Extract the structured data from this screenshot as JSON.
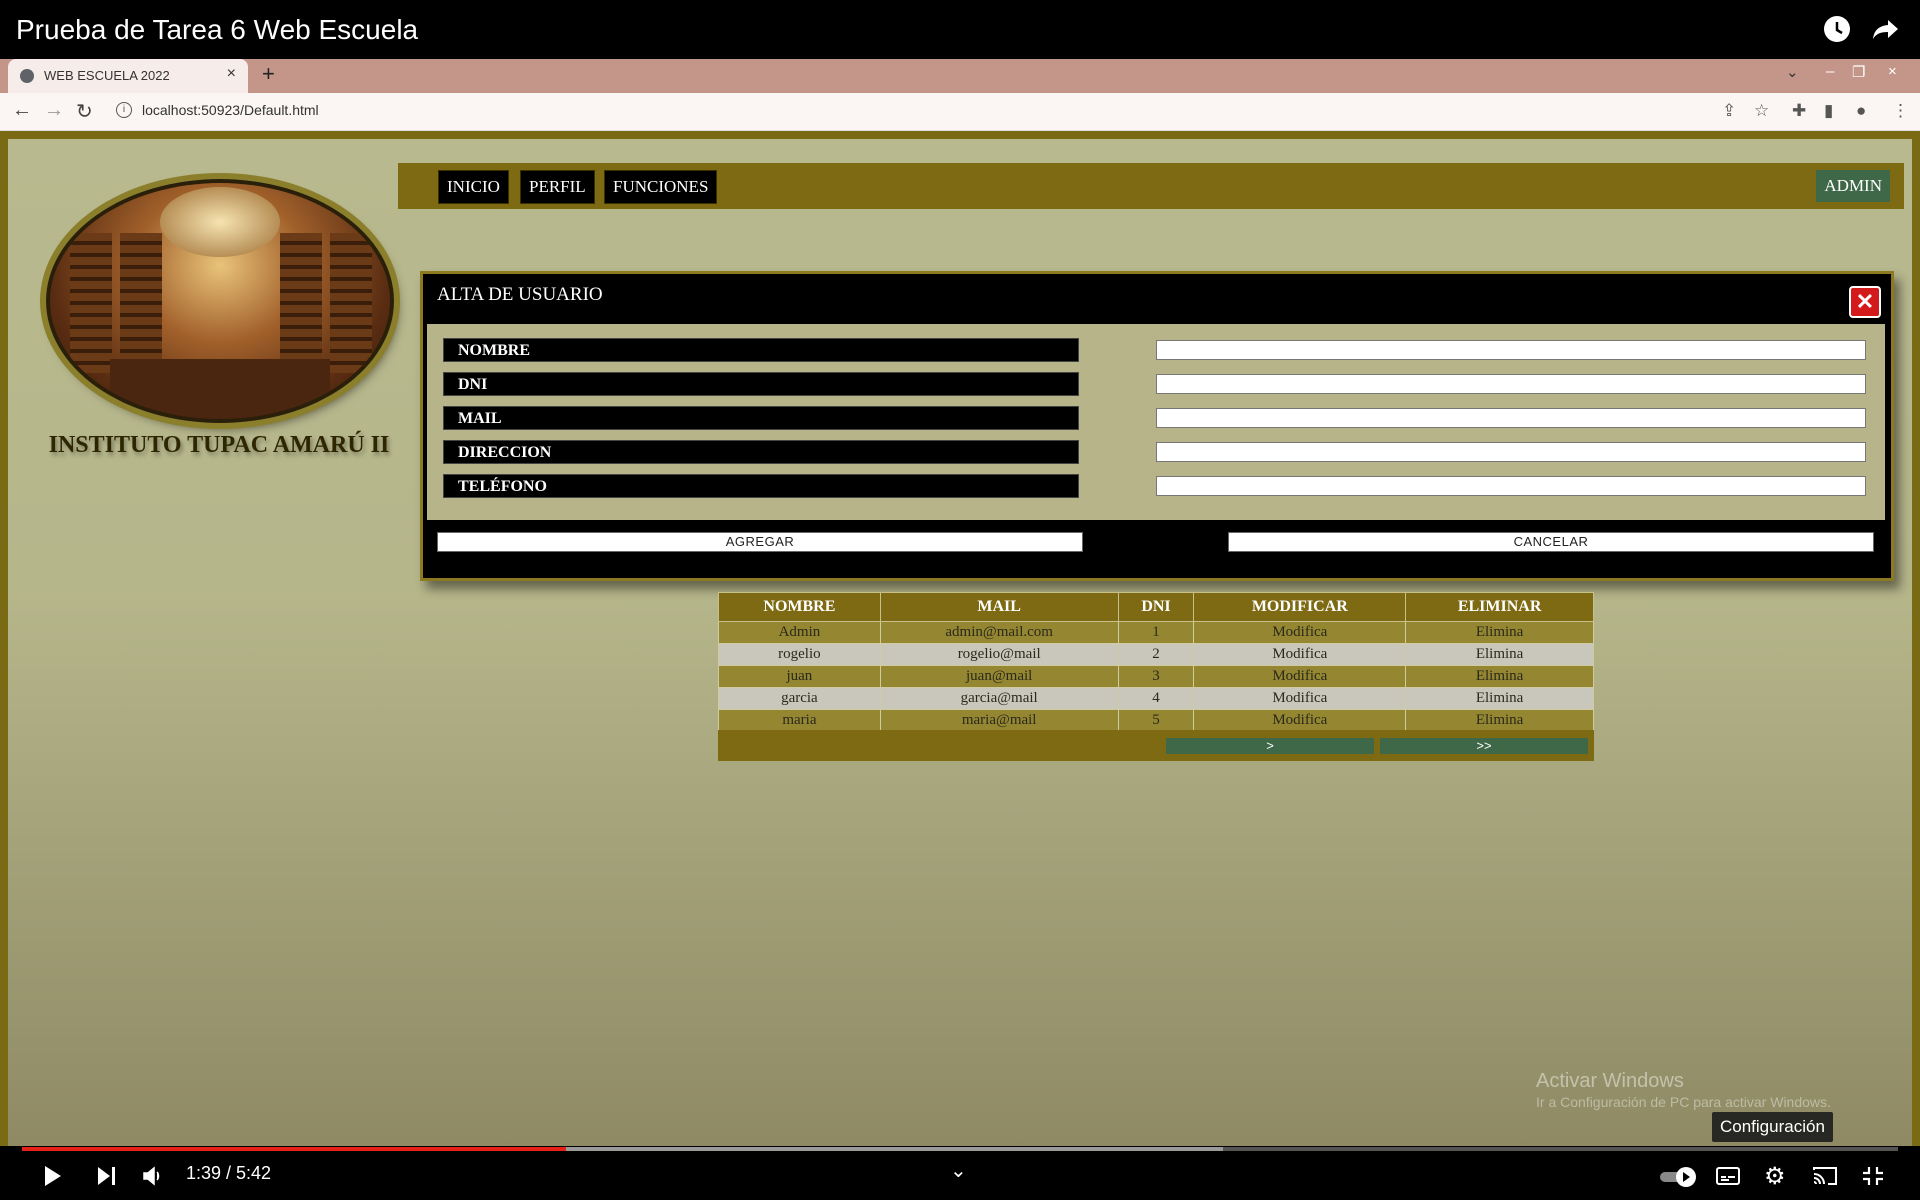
{
  "video": {
    "title": "Prueba de Tarea 6 Web Escuela",
    "time": "1:39 / 5:42",
    "progress_played": 0.29,
    "progress_buffered": 0.64,
    "tooltip": "Configuración"
  },
  "browser": {
    "tab_title": "WEB ESCUELA 2022",
    "url": "localhost:50923/Default.html"
  },
  "site": {
    "school_name": "INSTITUTO TUPAC AMARÚ II",
    "menu": [
      "INICIO",
      "PERFIL",
      "FUNCIONES"
    ],
    "admin_label": "ADMIN"
  },
  "modal": {
    "title": "ALTA DE USUARIO",
    "fields": [
      {
        "label": "NOMBRE",
        "value": ""
      },
      {
        "label": "DNI",
        "value": ""
      },
      {
        "label": "MAIL",
        "value": ""
      },
      {
        "label": "DIRECCION",
        "value": ""
      },
      {
        "label": "TELÉFONO",
        "value": ""
      }
    ],
    "add_label": "AGREGAR",
    "cancel_label": "CANCELAR"
  },
  "table": {
    "headers": [
      "NOMBRE",
      "MAIL",
      "DNI",
      "MODIFICAR",
      "ELIMINAR"
    ],
    "rows": [
      [
        "Admin",
        "admin@mail.com",
        "1",
        "Modifica",
        "Elimina"
      ],
      [
        "rogelio",
        "rogelio@mail",
        "2",
        "Modifica",
        "Elimina"
      ],
      [
        "juan",
        "juan@mail",
        "3",
        "Modifica",
        "Elimina"
      ],
      [
        "garcia",
        "garcia@mail",
        "4",
        "Modifica",
        "Elimina"
      ],
      [
        "maria",
        "maria@mail",
        "5",
        "Modifica",
        "Elimina"
      ]
    ],
    "pager": [
      ">",
      ">>"
    ]
  },
  "watermark": {
    "line1": "Activar Windows",
    "line2": "Ir a Configuración de PC para activar Windows."
  }
}
